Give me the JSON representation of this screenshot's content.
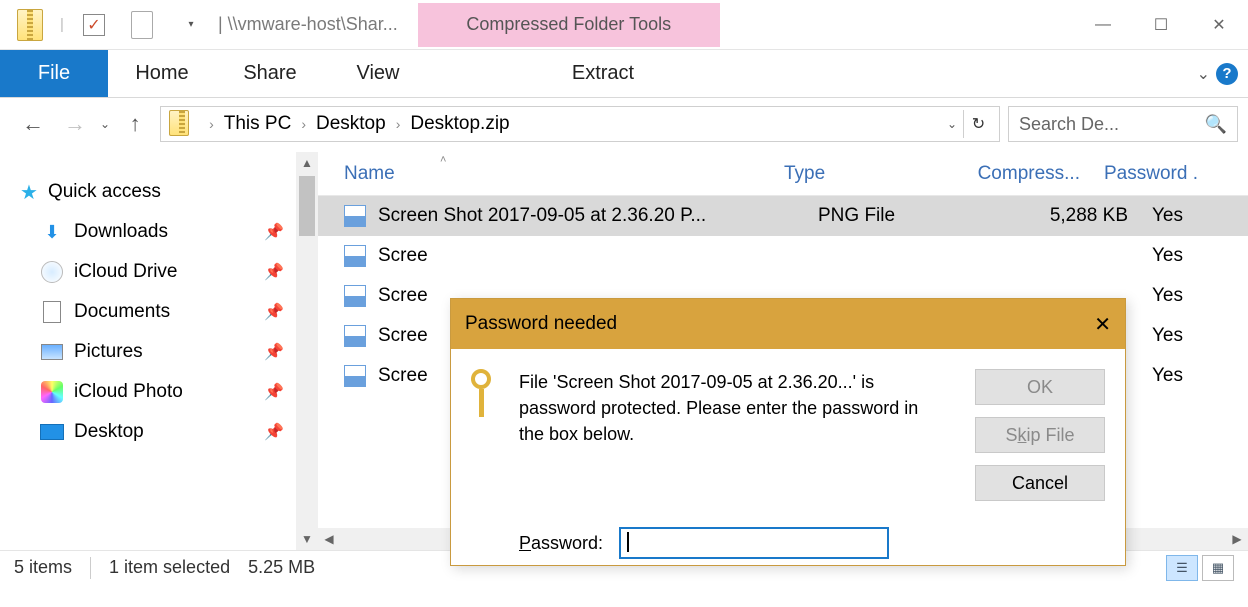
{
  "titlebar": {
    "path": "| \\\\vmware-host\\Shar...",
    "context_tab": "Compressed Folder Tools"
  },
  "ribbon": {
    "file": "File",
    "home": "Home",
    "share": "Share",
    "view": "View",
    "extract": "Extract"
  },
  "addr": {
    "crumbs": [
      "This PC",
      "Desktop",
      "Desktop.zip"
    ],
    "search_placeholder": "Search De..."
  },
  "sidebar": {
    "quick_access": "Quick access",
    "items": [
      {
        "label": "Downloads"
      },
      {
        "label": "iCloud Drive"
      },
      {
        "label": "Documents"
      },
      {
        "label": "Pictures"
      },
      {
        "label": "iCloud Photo"
      },
      {
        "label": "Desktop"
      }
    ]
  },
  "columns": {
    "name": "Name",
    "type": "Type",
    "compressed": "Compress...",
    "password": "Password ."
  },
  "files": [
    {
      "name": "Screen Shot 2017-09-05 at 2.36.20 P...",
      "type": "PNG File",
      "compressed": "5,288 KB",
      "password": "Yes",
      "selected": true
    },
    {
      "name": "Scree",
      "type": "",
      "compressed": "",
      "password": "Yes",
      "selected": false
    },
    {
      "name": "Scree",
      "type": "",
      "compressed": "",
      "password": "Yes",
      "selected": false
    },
    {
      "name": "Scree",
      "type": "",
      "compressed": "",
      "password": "Yes",
      "selected": false
    },
    {
      "name": "Scree",
      "type": "",
      "compressed": "",
      "password": "Yes",
      "selected": false
    }
  ],
  "statusbar": {
    "items": "5 items",
    "selected": "1 item selected",
    "size": "5.25 MB"
  },
  "dialog": {
    "title": "Password needed",
    "message": "File 'Screen Shot 2017-09-05 at 2.36.20...' is password protected.  Please enter the password in the box below.",
    "password_label_pre": "P",
    "password_label_post": "assword:",
    "ok": "OK",
    "skip": "Skip File",
    "cancel": "Cancel",
    "value": ""
  }
}
